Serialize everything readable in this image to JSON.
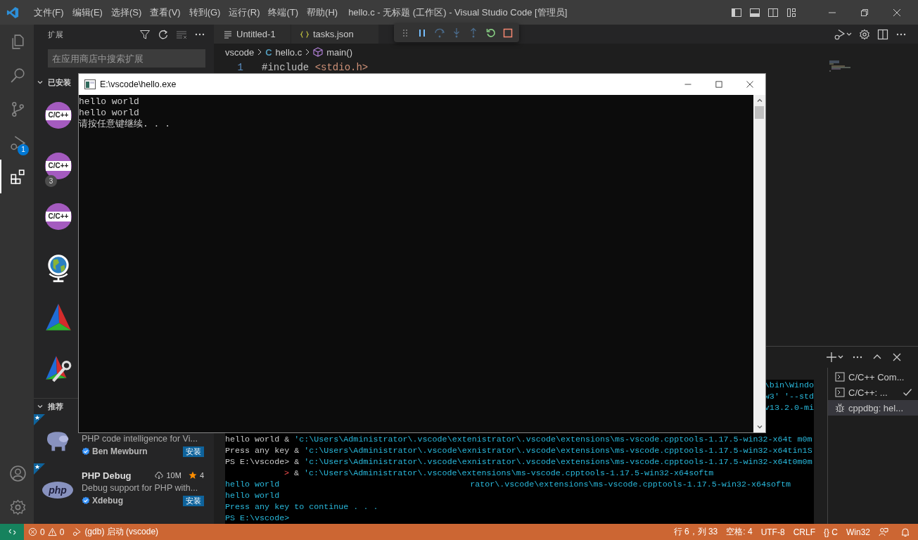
{
  "title_bar": {
    "menus": [
      "文件(F)",
      "编辑(E)",
      "选择(S)",
      "查看(V)",
      "转到(G)",
      "运行(R)",
      "终端(T)",
      "帮助(H)"
    ],
    "title": "hello.c - 无标题 (工作区) - Visual Studio Code [管理员]"
  },
  "activity_bar": {
    "items": [
      {
        "kind": "explorer",
        "selected": false
      },
      {
        "kind": "search",
        "selected": false
      },
      {
        "kind": "scm",
        "selected": false
      },
      {
        "kind": "debug",
        "selected": false,
        "badge": "1"
      },
      {
        "kind": "extensions",
        "selected": true
      }
    ],
    "bottom": [
      {
        "kind": "account"
      },
      {
        "kind": "manage"
      }
    ]
  },
  "sidebar": {
    "title": "扩展",
    "search": {
      "placeholder": "在应用商店中搜索扩展"
    },
    "installed": {
      "title": "已安装",
      "expanded": true,
      "extensions": [
        {
          "kind": "cpp",
          "logo_text": "C/C++"
        },
        {
          "kind": "cpp",
          "logo_text": "C/C++",
          "badge": "3"
        },
        {
          "kind": "cpp",
          "logo_text": "C/C++"
        },
        {
          "kind": "globe"
        },
        {
          "kind": "cmake"
        },
        {
          "kind": "cmake-tools"
        }
      ]
    },
    "recommended": {
      "title": "推荐",
      "expanded": true,
      "extensions": [
        {
          "kind": "elephant",
          "description": "PHP code intelligence for Vi...",
          "publisher": "Ben Mewburn",
          "verified": true,
          "action": "安装"
        },
        {
          "kind": "php",
          "logo_text": "php",
          "name": "PHP Debug",
          "downloads": "10M",
          "rating": "4",
          "description": "Debug support for PHP with...",
          "publisher": "Xdebug",
          "verified": true,
          "action": "安装"
        }
      ]
    }
  },
  "editor": {
    "tabs": [
      {
        "label": "Untitled-1",
        "kind": "text"
      },
      {
        "label": "tasks.json",
        "kind": "json"
      }
    ],
    "breadcrumb": [
      {
        "label": "vscode",
        "kind": "folder"
      },
      {
        "label": "hello.c",
        "kind": "c",
        "icon_text": "C"
      },
      {
        "label": "main()",
        "kind": "function"
      }
    ],
    "code_lines": [
      {
        "number": "1",
        "tokens": [
          {
            "text": "#include ",
            "kind": "directive"
          },
          {
            "text": "<stdio.h>",
            "kind": "string"
          }
        ]
      }
    ]
  },
  "panel": {
    "partial_lines": [
      "\\bin\\Windo",
      "w3' '--std",
      "v13.2.0-mi"
    ],
    "lines": [
      [
        {
          "text": "hello world ",
          "kind": "plain"
        },
        {
          "text": "& ",
          "kind": "plain"
        },
        {
          "text": "'c:\\Users\\Administrator\\.vscode\\extenistrator\\.vscode\\extensions\\ms-vscode.cpptools-1.17.5-win32-x64t m0m",
          "kind": "string"
        }
      ],
      [
        {
          "text": "Press any key ",
          "kind": "plain"
        },
        {
          "text": "& ",
          "kind": "plain"
        },
        {
          "text": "'c:\\Users\\Administrator\\.vscode\\exnistrator\\.vscode\\extensions\\ms-vscode.cpptools-1.17.5-win32-x64tin1S",
          "kind": "string"
        }
      ],
      [
        {
          "text": "PS E:\\vscode> ",
          "kind": "plain"
        },
        {
          "text": "& ",
          "kind": "plain"
        },
        {
          "text": "'c:\\Users\\Administrator\\.vscode\\exnistrator\\.vscode\\extensions\\ms-vscode.cpptools-1.17.5-win32-x64t0m0m",
          "kind": "string"
        }
      ],
      [
        {
          "text": "> ",
          "kind": "continuation"
        },
        {
          "text": "& ",
          "kind": "plain"
        },
        {
          "text": "'c:\\Users\\Administrator\\.vscode\\extensions\\ms-vscode.cpptools-1.17.5-win32-x64softm",
          "kind": "string"
        }
      ],
      [
        {
          "text": "hello world",
          "kind": "output"
        },
        {
          "text": "rator\\.vscode\\extensions\\ms-vscode.cpptools-1.17.5-win32-x64softm",
          "kind": "far"
        }
      ],
      [
        {
          "text": "hello world",
          "kind": "output"
        }
      ],
      [
        {
          "text": "Press any key to continue . . .",
          "kind": "output"
        }
      ],
      [
        {
          "text": "PS E:\\vscode>",
          "kind": "output"
        }
      ]
    ],
    "terminals": [
      {
        "label": "C/C++ Com...",
        "kind": "task",
        "done": false,
        "selected": false
      },
      {
        "label": "C/C++: ...",
        "kind": "task",
        "done": true,
        "selected": false
      },
      {
        "label": "cppdbg: hel...",
        "kind": "debug",
        "done": false,
        "selected": true
      }
    ]
  },
  "status_bar": {
    "errors": "0",
    "warnings": "0",
    "debug_config": "(gdb) 启动 (vscode)",
    "position": "行 6，列 33",
    "indent": "空格: 4",
    "encoding": "UTF-8",
    "eol": "CRLF",
    "language": "{} C",
    "platform": "Win32"
  },
  "console_window": {
    "title": "E:\\vscode\\hello.exe",
    "lines": [
      "hello world",
      "hello world",
      "请按任意键继续. . ."
    ]
  }
}
